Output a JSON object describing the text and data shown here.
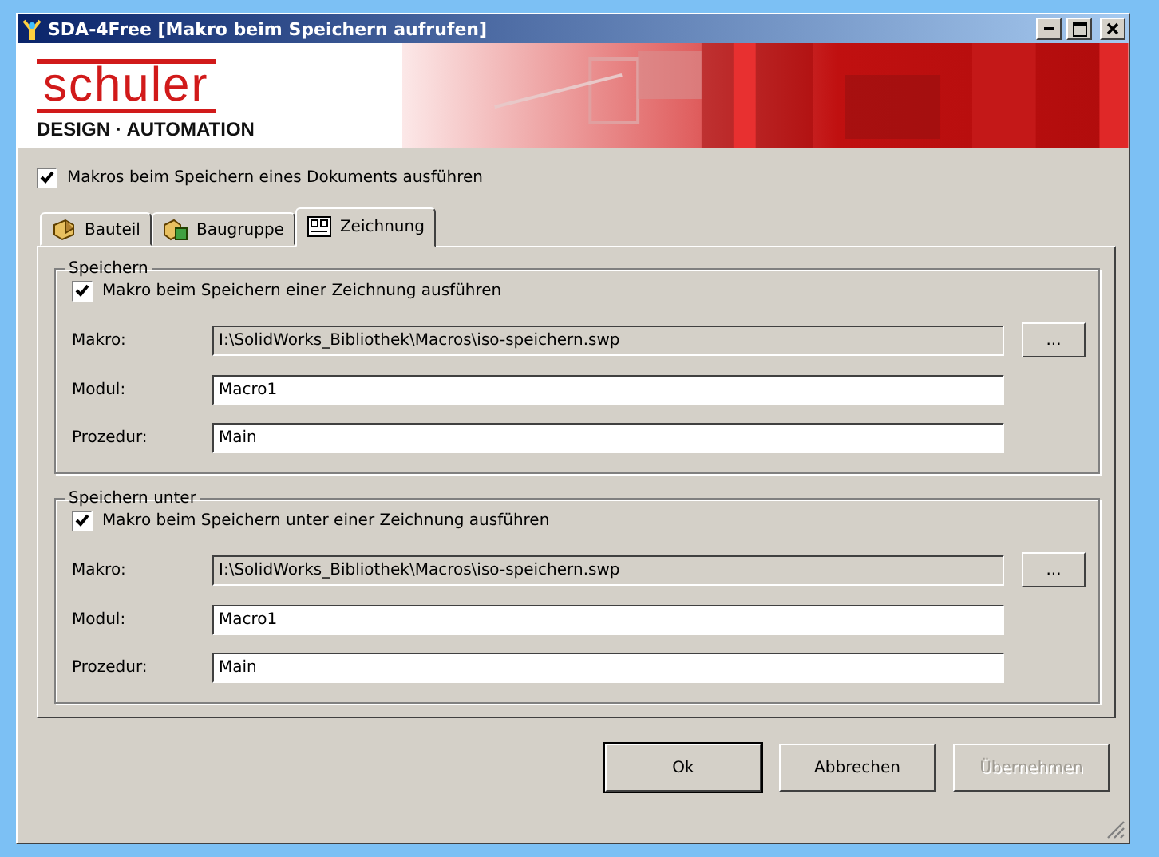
{
  "window": {
    "title": "SDA-4Free [Makro beim Speichern aufrufen]"
  },
  "banner": {
    "logo": "schuler",
    "tagline": "DESIGN · AUTOMATION"
  },
  "global_option": {
    "label": "Makros beim Speichern eines Dokuments ausführen",
    "checked": true
  },
  "tabs": [
    {
      "label": "Bauteil",
      "kind": "part",
      "selected": false
    },
    {
      "label": "Baugruppe",
      "kind": "assembly",
      "selected": false
    },
    {
      "label": "Zeichnung",
      "kind": "drawing",
      "selected": true
    }
  ],
  "groups": [
    {
      "title": "Speichern",
      "option": {
        "label": "Makro beim Speichern einer Zeichnung ausführen",
        "checked": true
      },
      "fields": [
        {
          "label": "Makro:",
          "value": "I:\\SolidWorks_Bibliothek\\Macros\\iso-speichern.swp",
          "kind": "readonly",
          "button": "..."
        },
        {
          "label": "Modul:",
          "value": "Macro1",
          "kind": "input"
        },
        {
          "label": "Prozedur:",
          "value": "Main",
          "kind": "input"
        }
      ]
    },
    {
      "title": "Speichern unter",
      "option": {
        "label": "Makro beim Speichern unter einer Zeichnung ausführen",
        "checked": true
      },
      "fields": [
        {
          "label": "Makro:",
          "value": "I:\\SolidWorks_Bibliothek\\Macros\\iso-speichern.swp",
          "kind": "readonly",
          "button": "..."
        },
        {
          "label": "Modul:",
          "value": "Macro1",
          "kind": "input"
        },
        {
          "label": "Prozedur:",
          "value": "Main",
          "kind": "input"
        }
      ]
    }
  ],
  "buttons": [
    {
      "label": "Ok",
      "default": true,
      "disabled": false
    },
    {
      "label": "Abbrechen",
      "default": false,
      "disabled": false
    },
    {
      "label": "Übernehmen",
      "default": false,
      "disabled": true
    }
  ]
}
